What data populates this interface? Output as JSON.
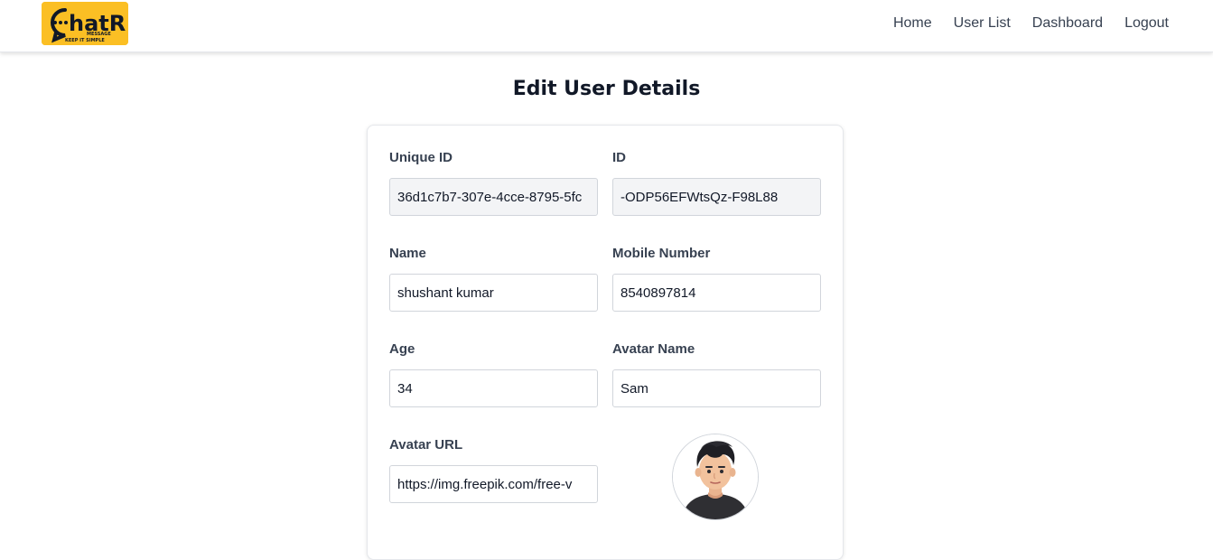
{
  "brand": {
    "logo_text": "hatR",
    "logo_sub": "MESSAGE",
    "logo_tagline": "KEEP IT SIMPLE"
  },
  "nav": {
    "items": [
      {
        "label": "Home"
      },
      {
        "label": "User List"
      },
      {
        "label": "Dashboard"
      },
      {
        "label": "Logout"
      }
    ]
  },
  "page": {
    "title": "Edit User Details"
  },
  "form": {
    "unique_id": {
      "label": "Unique ID",
      "value": "36d1c7b7-307e-4cce-8795-5fc"
    },
    "id": {
      "label": "ID",
      "value": "-ODP56EFWtsQz-F98L88"
    },
    "name": {
      "label": "Name",
      "value": "shushant kumar"
    },
    "mobile": {
      "label": "Mobile Number",
      "value": "8540897814"
    },
    "age": {
      "label": "Age",
      "value": "34"
    },
    "avatar_name": {
      "label": "Avatar Name",
      "value": "Sam"
    },
    "avatar_url": {
      "label": "Avatar URL",
      "value": "https://img.freepik.com/free-v"
    }
  },
  "colors": {
    "brand_yellow": "#fbbf24",
    "input_readonly_bg": "#f3f4f6",
    "border": "#d1d5db"
  }
}
